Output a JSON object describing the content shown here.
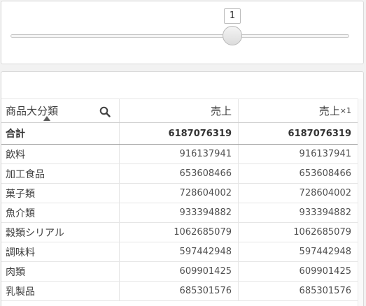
{
  "slider": {
    "value": "1"
  },
  "table": {
    "headers": {
      "dimension": "商品大分類",
      "measure1": "売上",
      "measure2": "売上",
      "measure2_suffix": "×1"
    },
    "total": {
      "label": "合計",
      "measure1": "6187076319",
      "measure2": "6187076319"
    },
    "rows": [
      {
        "label": "飲料",
        "measure1": "916137941",
        "measure2": "916137941"
      },
      {
        "label": "加工食品",
        "measure1": "653608466",
        "measure2": "653608466"
      },
      {
        "label": "菓子類",
        "measure1": "728604002",
        "measure2": "728604002"
      },
      {
        "label": "魚介類",
        "measure1": "933394882",
        "measure2": "933394882"
      },
      {
        "label": "穀類シリアル",
        "measure1": "1062685079",
        "measure2": "1062685079"
      },
      {
        "label": "調味料",
        "measure1": "597442948",
        "measure2": "597442948"
      },
      {
        "label": "肉類",
        "measure1": "609901425",
        "measure2": "609901425"
      },
      {
        "label": "乳製品",
        "measure1": "685301576",
        "measure2": "685301576"
      }
    ]
  }
}
